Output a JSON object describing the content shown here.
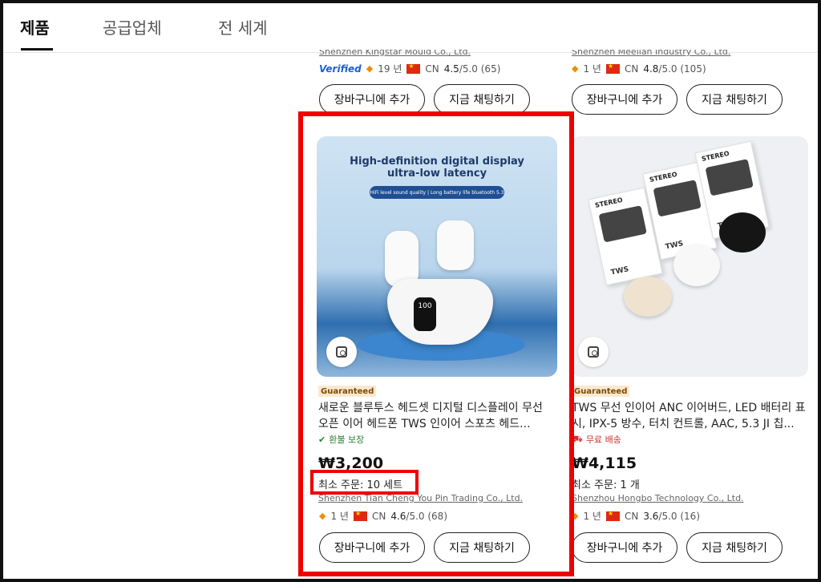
{
  "tabs": [
    {
      "label": "제품",
      "active": true
    },
    {
      "label": "공급업체",
      "active": false
    },
    {
      "label": "전 세계",
      "active": false
    }
  ],
  "top_row": [
    {
      "supplier": "Shenzhen Kingstar Mould Co., Ltd.",
      "verified": "Verified",
      "years": "19 년",
      "country": "CN",
      "rating": "4.5",
      "rating_suffix": "/5.0 (65)",
      "cart_label": "장바구니에 추가",
      "chat_label": "지금 채팅하기"
    },
    {
      "supplier": "Shenzhen Meellan Industry Co., Ltd.",
      "years": "1 년",
      "country": "CN",
      "rating": "4.8",
      "rating_suffix": "/5.0 (105)",
      "cart_label": "장바구니에 추가",
      "chat_label": "지금 채팅하기"
    }
  ],
  "products": [
    {
      "image_headline": "High-definition digital display ultra-low latency",
      "image_pill": "HiFi level sound quality | Long battery life bluetooth 5.3",
      "case_display": "100",
      "badge": "Guaranteed",
      "title": "새로운 블루투스 헤드셋 디지털 디스플레이 무선 오픈 이어 헤드폰 TWS 인이어 스포츠 헤드...",
      "perk": "환불 보장",
      "perk_icon": "shield-check-icon",
      "price": "₩3,200",
      "moq": "최소 주문: 10 세트",
      "supplier": "Shenzhen Tian Cheng You Pin Trading Co., Ltd.",
      "years": "1 년",
      "country": "CN",
      "rating": "4.6",
      "rating_suffix": "/5.0 (68)",
      "cart_label": "장바구니에 추가",
      "chat_label": "지금 채팅하기"
    },
    {
      "badge": "Guaranteed",
      "box_brand": "STEREO",
      "box_model": "TWS",
      "title": "TWS 무선 인이어 ANC 이어버드, LED 배터리 표시, IPX-5 방수, 터치 컨트롤, AAC, 5.3 JI 칩...",
      "perk": "무료 배송",
      "perk_icon": "truck-icon",
      "price": "₩4,115",
      "moq": "최소 주문: 1 개",
      "supplier": "Shenzhou Hongbo Technology Co., Ltd.",
      "years": "1 년",
      "country": "CN",
      "rating": "3.6",
      "rating_suffix": "/5.0 (16)",
      "cart_label": "장바구니에 추가",
      "chat_label": "지금 채팅하기"
    }
  ],
  "colors": {
    "highlight": "#ee0000",
    "guaranteed_bg": "#fde8cf",
    "refund_green": "#2e7d32",
    "shipping_red": "#d32f2f",
    "verified_blue": "#1a5fd6"
  }
}
